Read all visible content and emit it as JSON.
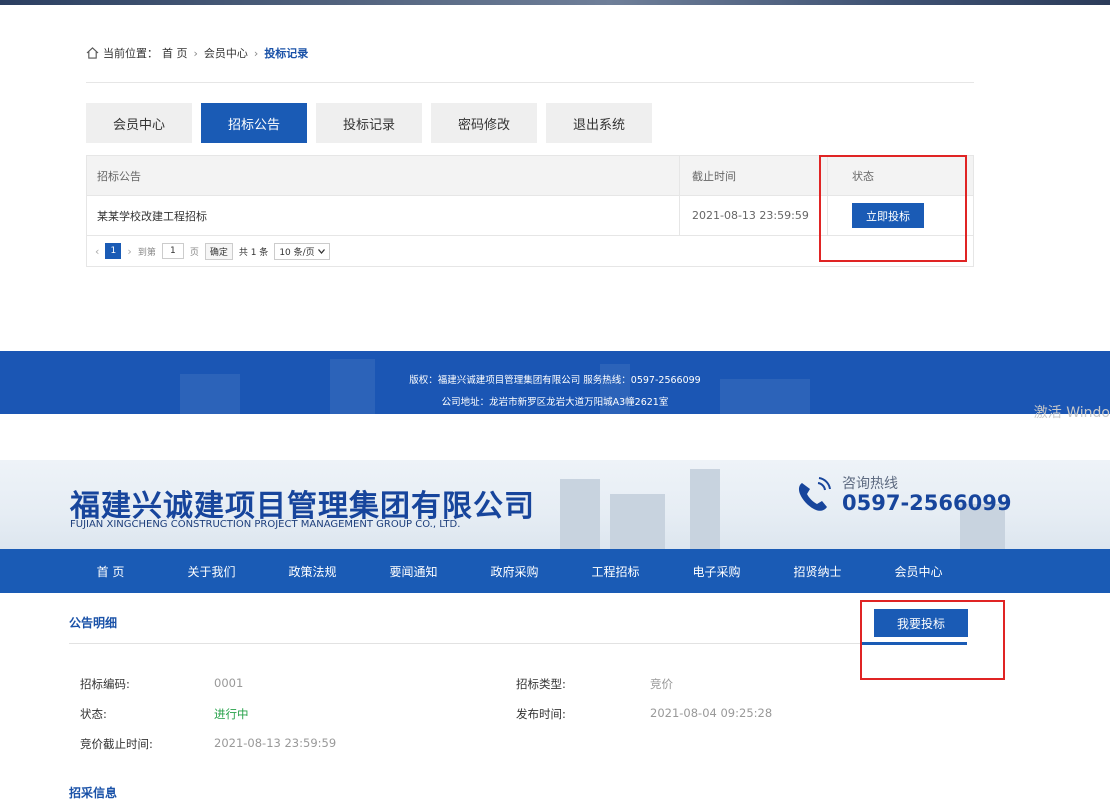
{
  "breadcrumb": {
    "prefix": "当前位置：",
    "home": "首 页",
    "member": "会员中心",
    "current": "投标记录"
  },
  "tabs": [
    {
      "label": "会员中心",
      "active": false
    },
    {
      "label": "招标公告",
      "active": true
    },
    {
      "label": "投标记录",
      "active": false
    },
    {
      "label": "密码修改",
      "active": false
    },
    {
      "label": "退出系统",
      "active": false
    }
  ],
  "table": {
    "headers": [
      "招标公告",
      "截止时间",
      "状态"
    ],
    "rows": [
      {
        "title": "某某学校改建工程招标",
        "deadline": "2021-08-13 23:59:59",
        "action": "立即投标"
      }
    ]
  },
  "pager": {
    "current": "1",
    "goto_label": "到第",
    "goto_value": "1",
    "page_label": "页",
    "confirm": "确定",
    "total": "共 1 条",
    "page_size": "10 条/页"
  },
  "footer": {
    "line1": "版权：福建兴诚建项目管理集团有限公司  服务热线：0597-2566099",
    "line2": "公司地址：龙岩市新罗区龙岩大道万阳城A3幢2621室"
  },
  "watermark": "激活 Windo",
  "header": {
    "company_cn": "福建兴诚建项目管理集团有限公司",
    "company_en": "FUJIAN XINGCHENG CONSTRUCTION PROJECT MANAGEMENT GROUP CO., LTD.",
    "hotline_label": "咨询热线",
    "hotline_number": "0597-2566099"
  },
  "nav": [
    "首 页",
    "关于我们",
    "政策法规",
    "要闻通知",
    "政府采购",
    "工程招标",
    "电子采购",
    "招贤纳士",
    "会员中心"
  ],
  "detail": {
    "section_title": "公告明细",
    "bid_button": "我要投标",
    "code_label": "招标编码:",
    "code_value": "0001",
    "status_label": "状态:",
    "status_value": "进行中",
    "deadline_label": "竞价截止时间:",
    "deadline_value": "2021-08-13 23:59:59",
    "type_label": "招标类型:",
    "type_value": "竞价",
    "publish_label": "发布时间:",
    "publish_value": "2021-08-04 09:25:28",
    "info_title": "招采信息"
  },
  "colors": {
    "primary": "#1a5bb5",
    "highlight": "#e02424",
    "status_green": "#27a14a"
  }
}
